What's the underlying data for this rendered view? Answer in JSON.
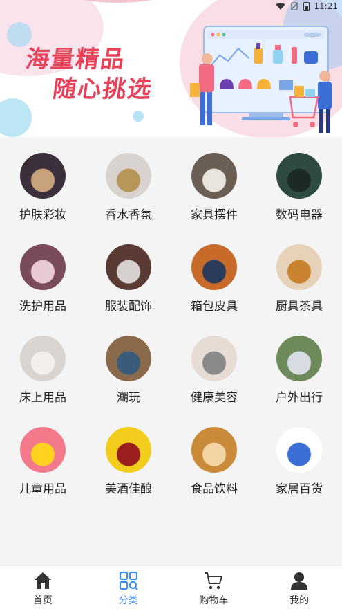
{
  "status_bar": {
    "time": "11:21"
  },
  "banner": {
    "line1": "海量精品",
    "line2": "随心挑选"
  },
  "categories": [
    {
      "label": "护肤彩妆",
      "icon": "skincare-makeup-image",
      "bg": "#3a2f3a",
      "accent": "#c8a27a"
    },
    {
      "label": "香水香氛",
      "icon": "perfume-image",
      "bg": "#d8d3cf",
      "accent": "#b89658"
    },
    {
      "label": "家具摆件",
      "icon": "furniture-decor-image",
      "bg": "#6a5e55",
      "accent": "#e9e4dc"
    },
    {
      "label": "数码电器",
      "icon": "digital-appliance-image",
      "bg": "#2f4a40",
      "accent": "#1c2a25"
    },
    {
      "label": "洗护用品",
      "icon": "toiletries-image",
      "bg": "#7a4b5a",
      "accent": "#e9c9d2"
    },
    {
      "label": "服装配饰",
      "icon": "clothing-accessory-image",
      "bg": "#5a3b33",
      "accent": "#d6d1cd"
    },
    {
      "label": "箱包皮具",
      "icon": "bags-leather-image",
      "bg": "#c76a2a",
      "accent": "#2b3b5a"
    },
    {
      "label": "厨具茶具",
      "icon": "kitchen-tea-image",
      "bg": "#e6d2b8",
      "accent": "#c9832f"
    },
    {
      "label": "床上用品",
      "icon": "bedding-image",
      "bg": "#d9d4cf",
      "accent": "#f3f0ec"
    },
    {
      "label": "潮玩",
      "icon": "trendy-toys-image",
      "bg": "#8a6a4a",
      "accent": "#3a5b7a"
    },
    {
      "label": "健康美容",
      "icon": "health-beauty-image",
      "bg": "#e7dcd3",
      "accent": "#8a8a8a"
    },
    {
      "label": "户外出行",
      "icon": "outdoor-travel-image",
      "bg": "#6f8a5a",
      "accent": "#d8dde3"
    },
    {
      "label": "儿童用品",
      "icon": "kids-products-image",
      "bg": "#f27a8a",
      "accent": "#ffd21f"
    },
    {
      "label": "美酒佳酿",
      "icon": "wine-image",
      "bg": "#f3cd1d",
      "accent": "#9c1f1f"
    },
    {
      "label": "食品饮料",
      "icon": "food-drinks-image",
      "bg": "#c98a3a",
      "accent": "#f2d3a3"
    },
    {
      "label": "家居百货",
      "icon": "household-goods-image",
      "bg": "#ffffff",
      "accent": "#3b6fd6"
    }
  ],
  "tabbar": {
    "tabs": [
      {
        "label": "首页",
        "icon": "home-icon"
      },
      {
        "label": "分类",
        "icon": "category-icon"
      },
      {
        "label": "购物车",
        "icon": "cart-icon"
      },
      {
        "label": "我的",
        "icon": "profile-icon"
      }
    ],
    "active_color": "#3c8ef2"
  }
}
